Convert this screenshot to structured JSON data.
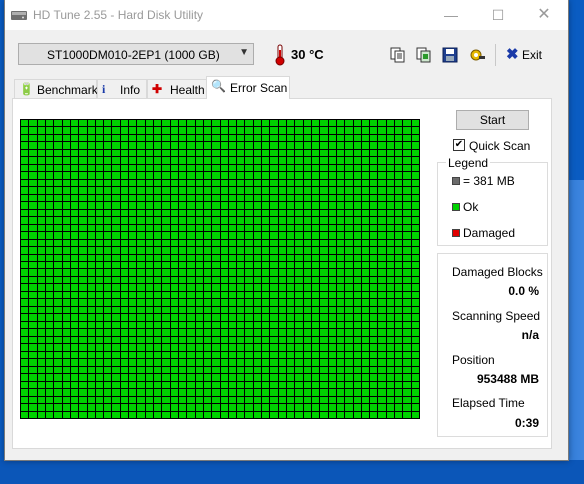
{
  "window": {
    "title": "HD Tune 2.55 - Hard Disk Utility",
    "minimize_glyph": "—",
    "maximize_glyph": "☐",
    "close_glyph": "✕"
  },
  "toolbar": {
    "drive": "ST1000DM010-2EP1 (1000 GB)",
    "temperature": "30 °C",
    "exit_label": "Exit",
    "exit_glyph": "✖",
    "dropdown_glyph": "▼",
    "icons": [
      "copy-info-icon",
      "copy-screen-icon",
      "save-icon",
      "options-icon"
    ]
  },
  "tabs": [
    {
      "label": "Benchmark",
      "icon": "benchmark-icon"
    },
    {
      "label": "Info",
      "icon": "info-icon"
    },
    {
      "label": "Health",
      "icon": "health-icon"
    },
    {
      "label": "Error Scan",
      "icon": "magnifier-icon",
      "active": true
    }
  ],
  "scan": {
    "start_label": "Start",
    "quick_scan_label": "Quick Scan",
    "quick_scan_checked": true,
    "block_grid": {
      "columns": 48,
      "rows": 40,
      "state": "ok"
    }
  },
  "legend": {
    "title": "Legend",
    "items": [
      {
        "label": "= 381 MB",
        "color": "#6b6b6b"
      },
      {
        "label": "Ok",
        "color": "#00d200"
      },
      {
        "label": "Damaged",
        "color": "#e00000"
      }
    ]
  },
  "stats": {
    "damaged_blocks_label": "Damaged Blocks",
    "damaged_blocks_value": "0.0 %",
    "scanning_speed_label": "Scanning Speed",
    "scanning_speed_value": "n/a",
    "position_label": "Position",
    "position_value": "953488 MB",
    "elapsed_time_label": "Elapsed Time",
    "elapsed_time_value": "0:39"
  },
  "colors": {
    "ok_block": "#00d200",
    "grid_lines": "#000000",
    "desktop": "#0a5cc2"
  }
}
